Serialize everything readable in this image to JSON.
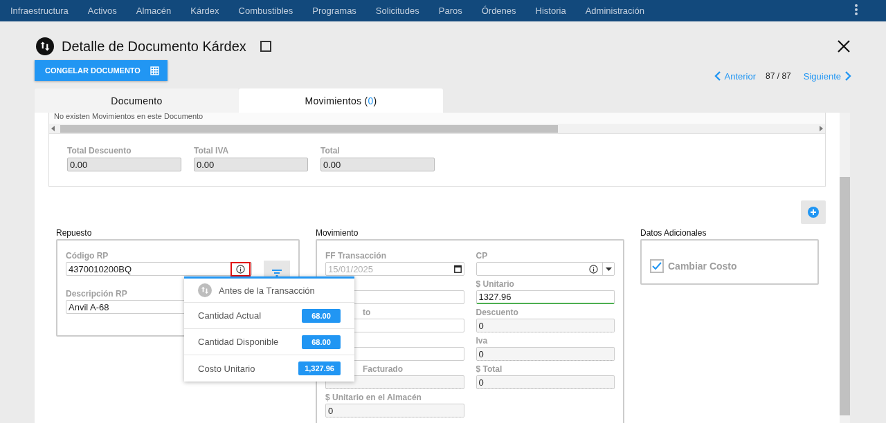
{
  "nav": {
    "items": [
      "Infraestructura",
      "Activos",
      "Almacén",
      "Kárdex",
      "Combustibles",
      "Programas",
      "Solicitudes",
      "Paros",
      "Órdenes",
      "Historia",
      "Administración"
    ]
  },
  "header": {
    "title": "Detalle de Documento Kárdex",
    "checked": false
  },
  "freeze_button": {
    "label": "CONGELAR DOCUMENTO"
  },
  "pager": {
    "prev": "Anterior",
    "position": "87 / 87",
    "next": "Siguiente"
  },
  "tabs": [
    {
      "label": "Documento",
      "selected": false
    },
    {
      "label": "Movimientos",
      "count_open": "(",
      "count": "0",
      "count_close": ")",
      "selected": true
    }
  ],
  "grid": {
    "empty_message": "No existen Movimientos en este Documento"
  },
  "totals": [
    {
      "label": "Total Descuento",
      "value": "0.00"
    },
    {
      "label": "Total IVA",
      "value": "0.00"
    },
    {
      "label": "Total",
      "value": "0.00"
    }
  ],
  "repuesto": {
    "title": "Repuesto",
    "fields": [
      {
        "label": "Código RP",
        "value": "4370010200BQ",
        "info": true,
        "highlighted": true
      },
      {
        "label": "Descripción RP",
        "value": "Anvil A-68"
      }
    ]
  },
  "movimiento": {
    "title": "Movimiento",
    "left_fields": [
      {
        "label": "FF Transacción",
        "value": "15/01/2025",
        "kind": "date"
      },
      {
        "kind": "text"
      },
      {
        "label": "to",
        "kind": "text",
        "covered": true
      },
      {
        "kind": "text"
      },
      {
        "label": "Facturado",
        "kind": "readonly",
        "covered": true
      },
      {
        "label": "$ Unitario en el Almacén",
        "value": "0",
        "kind": "readonly"
      }
    ],
    "right_fields": [
      {
        "label": "CP",
        "kind": "select"
      },
      {
        "label": "$ Unitario",
        "value": "1327.96",
        "kind": "focused"
      },
      {
        "label": "Descuento",
        "value": "0",
        "kind": "readonly"
      },
      {
        "label": "Iva",
        "value": "0",
        "kind": "readonly"
      },
      {
        "label": "$ Total",
        "value": "0",
        "kind": "readonly"
      }
    ]
  },
  "datos": {
    "title": "Datos Adicionales",
    "options": [
      {
        "label": "Cambiar Costo",
        "checked": true
      }
    ]
  },
  "popup": {
    "title": "Antes de la Transacción",
    "rows": [
      {
        "label": "Cantidad Actual",
        "value": "68.00"
      },
      {
        "label": "Cantidad Disponible",
        "value": "68.00"
      },
      {
        "label": "Costo Unitario",
        "value": "1,327.96"
      }
    ]
  }
}
